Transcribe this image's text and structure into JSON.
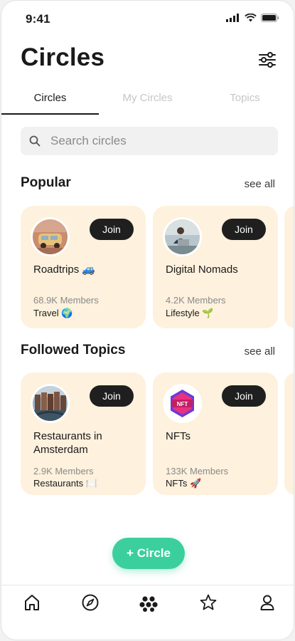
{
  "status": {
    "time": "9:41"
  },
  "header": {
    "title": "Circles"
  },
  "tabs": [
    {
      "label": "Circles",
      "active": true
    },
    {
      "label": "My Circles",
      "active": false
    },
    {
      "label": "Topics",
      "active": false
    }
  ],
  "search": {
    "placeholder": "Search circles"
  },
  "popular": {
    "title": "Popular",
    "see_all": "see all",
    "cards": [
      {
        "name": "Roadtrips 🚙",
        "members": "68.9K Members",
        "category": "Travel 🌍",
        "join": "Join",
        "image": "roadtrip-photo"
      },
      {
        "name": "Digital Nomads",
        "members": "4.2K Members",
        "category": "Lifestyle 🌱",
        "join": "Join",
        "image": "laptop-photo"
      }
    ]
  },
  "followed": {
    "title": "Followed Topics",
    "see_all": "see all",
    "cards": [
      {
        "name": "Restaurants in Amsterdam",
        "members": "2.9K Members",
        "category": "Restaurants 🍽️",
        "join": "Join",
        "image": "amsterdam-photo"
      },
      {
        "name": "NFTs",
        "members": "133K Members",
        "category": "NFTs 🚀",
        "join": "Join",
        "image": "nft-badge"
      }
    ]
  },
  "add_button": {
    "label": "+ Circle",
    "color": "#3ccf9e"
  },
  "bottom_nav": [
    "home-icon",
    "compass-icon",
    "circles-icon",
    "star-icon",
    "profile-icon"
  ]
}
